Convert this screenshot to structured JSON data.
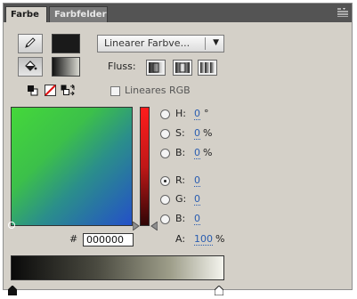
{
  "tabs": [
    {
      "label": "Farbe"
    },
    {
      "label": "Farbfelder"
    }
  ],
  "fill": {
    "type_dropdown": "Linearer Farbve...",
    "flow_label": "Fluss:",
    "linear_rgb_label": "Lineares RGB",
    "linear_rgb_checked": false
  },
  "hsb": {
    "h": {
      "label": "H:",
      "value": "0",
      "unit": "°"
    },
    "s": {
      "label": "S:",
      "value": "0",
      "unit": "%"
    },
    "b": {
      "label": "B:",
      "value": "0",
      "unit": "%"
    }
  },
  "rgb": {
    "r": {
      "label": "R:",
      "value": "0"
    },
    "g": {
      "label": "G:",
      "value": "0"
    },
    "b": {
      "label": "B:",
      "value": "0"
    }
  },
  "selected_mode": "R",
  "hex": {
    "prefix": "#",
    "value": "000000"
  },
  "alpha": {
    "label": "A:",
    "value": "100",
    "unit": "%"
  },
  "colors": {
    "stroke_swatch": "#1a1a1a",
    "gradient_start": "#0a0a0a",
    "gradient_end": "#f4f4ee"
  },
  "icons": [
    "pencil-icon",
    "paint-bucket-icon",
    "panel-menu-icon",
    "black-white-icon",
    "no-color-icon",
    "swap-colors-icon"
  ]
}
